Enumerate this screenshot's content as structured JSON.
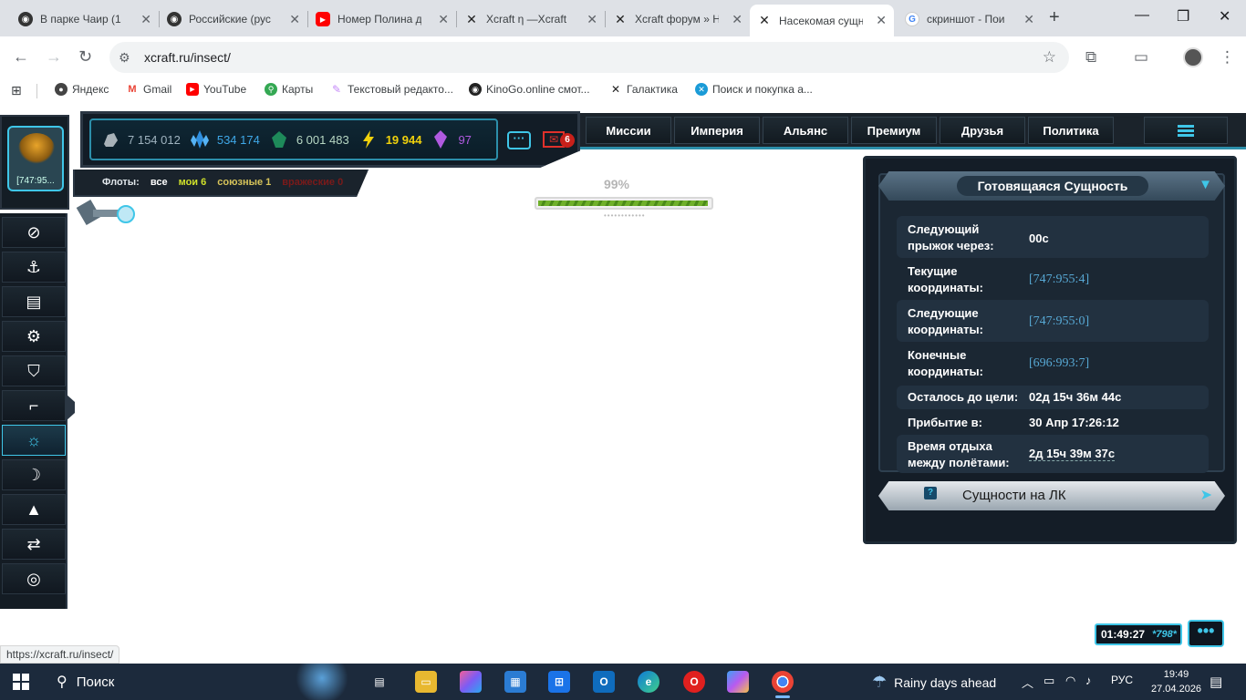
{
  "browser": {
    "tabs": [
      {
        "label": "В парке Чаир (1",
        "icon": "avatar-icon",
        "color": "#333333"
      },
      {
        "label": "Российские (рус",
        "icon": "avatar-icon",
        "color": "#333333"
      },
      {
        "label": "Номер Полина д",
        "icon": "youtube-icon",
        "color": "#ff0000"
      },
      {
        "label": "Xcraft η —Xcraft",
        "icon": "xcraft-icon",
        "color": "#222222"
      },
      {
        "label": "Xcraft форум » Н",
        "icon": "xcraft-icon",
        "color": "#222222"
      },
      {
        "label": "Насекомая сущн",
        "icon": "xcraft-icon",
        "color": "#222222",
        "active": true
      },
      {
        "label": "скриншот - Пои",
        "icon": "google-icon",
        "color": "#4285f4"
      }
    ],
    "url": "xcraft.ru/insect/",
    "status_url": "https://xcraft.ru/insect/",
    "bookmarks": [
      {
        "label": "Яндекс",
        "color": "#444444"
      },
      {
        "label": "Gmail",
        "color": "#ea4335"
      },
      {
        "label": "YouTube",
        "color": "#ff0000"
      },
      {
        "label": "Карты",
        "color": "#34a853"
      },
      {
        "label": "Текстовый редакто...",
        "color": "#c58af9"
      },
      {
        "label": "KinoGo.online смот...",
        "color": "#222222"
      },
      {
        "label": "Галактика",
        "color": "#222222"
      },
      {
        "label": "Поиск и покупка а...",
        "color": "#1a9bd7"
      }
    ]
  },
  "game": {
    "avatar_coord": "[747:95...",
    "resources": [
      {
        "value": "7 154 012",
        "color": "#9fb3bf",
        "icon": "metal-icon"
      },
      {
        "value": "534 174",
        "color": "#3fa8e8",
        "icon": "crystal-icon"
      },
      {
        "value": "6 001 483",
        "color": "#b7d7c3",
        "icon": "deuterium-icon"
      },
      {
        "value": "19 944",
        "color": "#f0d10c",
        "icon": "energy-icon"
      },
      {
        "value": "97",
        "color": "#b05ae0",
        "icon": "gem-icon"
      }
    ],
    "mail_count": "6",
    "fleets": {
      "label": "Флоты:",
      "all": "все",
      "mine": "мои 6",
      "allied": "союзные 1",
      "hostile": "вражеские 0"
    },
    "menu": [
      "Миссии",
      "Империя",
      "Альянс",
      "Премиум",
      "Друзья",
      "Политика"
    ],
    "progress": {
      "percent_label": "99%",
      "value": 0.99
    },
    "panel": {
      "title": "Готовящаяся Сущность",
      "rows": [
        {
          "label": "Следующий прыжок через:",
          "value": "00с",
          "kind": "plain"
        },
        {
          "label": "Текущие координаты:",
          "value": "[747:955:4]",
          "kind": "link"
        },
        {
          "label": "Следующие координаты:",
          "value": "[747:955:0]",
          "kind": "link"
        },
        {
          "label": "Конечные координаты:",
          "value": "[696:993:7]",
          "kind": "link"
        },
        {
          "label": "Осталось до цели:",
          "value": "02д 15ч 36м 44с",
          "kind": "plain"
        },
        {
          "label": "Прибытие в:",
          "value": "30 Апр 17:26:12",
          "kind": "plain"
        },
        {
          "label": "Время отдыха между полётами:",
          "value": "2д 15ч 39м 37с",
          "kind": "dash"
        }
      ],
      "footer": "Сущности на ЛК",
      "footer_help": "?"
    },
    "clock": {
      "time": "01:49:27",
      "server": "*798*"
    }
  },
  "taskbar": {
    "search": "Поиск",
    "weather": "Rainy days ahead",
    "lang": "РУС",
    "time": "19:49",
    "date": "27.04.2026"
  }
}
